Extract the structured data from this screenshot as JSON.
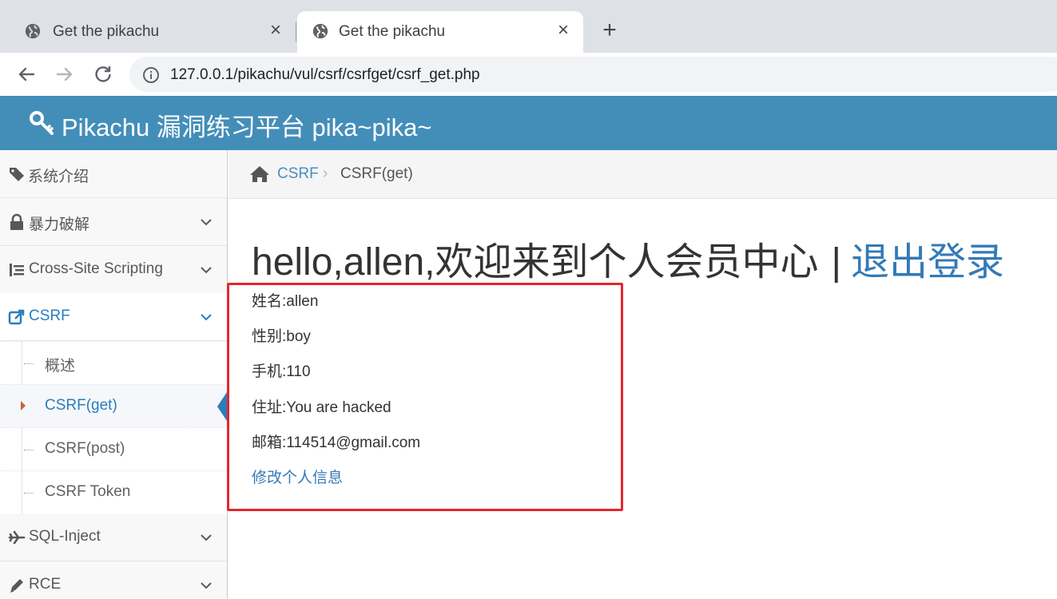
{
  "browser": {
    "tabs": [
      {
        "title": "Get the pikachu",
        "active": false
      },
      {
        "title": "Get the pikachu",
        "active": true
      }
    ],
    "url": "127.0.0.1/pikachu/vul/csrf/csrfget/csrf_get.php"
  },
  "header": {
    "brand": "Pikachu 漏洞练习平台 pika~pika~"
  },
  "sidebar": {
    "items": [
      {
        "label": "系统介绍",
        "icon": "tags-icon"
      },
      {
        "label": "暴力破解",
        "icon": "lock-icon"
      },
      {
        "label": "Cross-Site Scripting",
        "icon": "list-icon"
      },
      {
        "label": "CSRF",
        "icon": "share-icon"
      },
      {
        "label": "SQL-Inject",
        "icon": "plane-icon"
      },
      {
        "label": "RCE",
        "icon": "pencil-icon"
      }
    ],
    "csrf_submenu": [
      {
        "label": "概述"
      },
      {
        "label": "CSRF(get)"
      },
      {
        "label": "CSRF(post)"
      },
      {
        "label": "CSRF Token"
      }
    ]
  },
  "breadcrumb": {
    "parent": "CSRF",
    "current": "CSRF(get)"
  },
  "main": {
    "welcome": "hello,allen,欢迎来到个人会员中心",
    "separator": "|",
    "logout": "退出登录",
    "fields": {
      "name": "姓名:allen",
      "sex": "性别:boy",
      "phone": "手机:110",
      "address": "住址:You are hacked",
      "email": "邮箱:114514@gmail.com"
    },
    "edit_link": "修改个人信息"
  },
  "colors": {
    "header_blue": "#438eb9",
    "link_blue": "#337ab7",
    "highlight_red": "#e3262d"
  }
}
